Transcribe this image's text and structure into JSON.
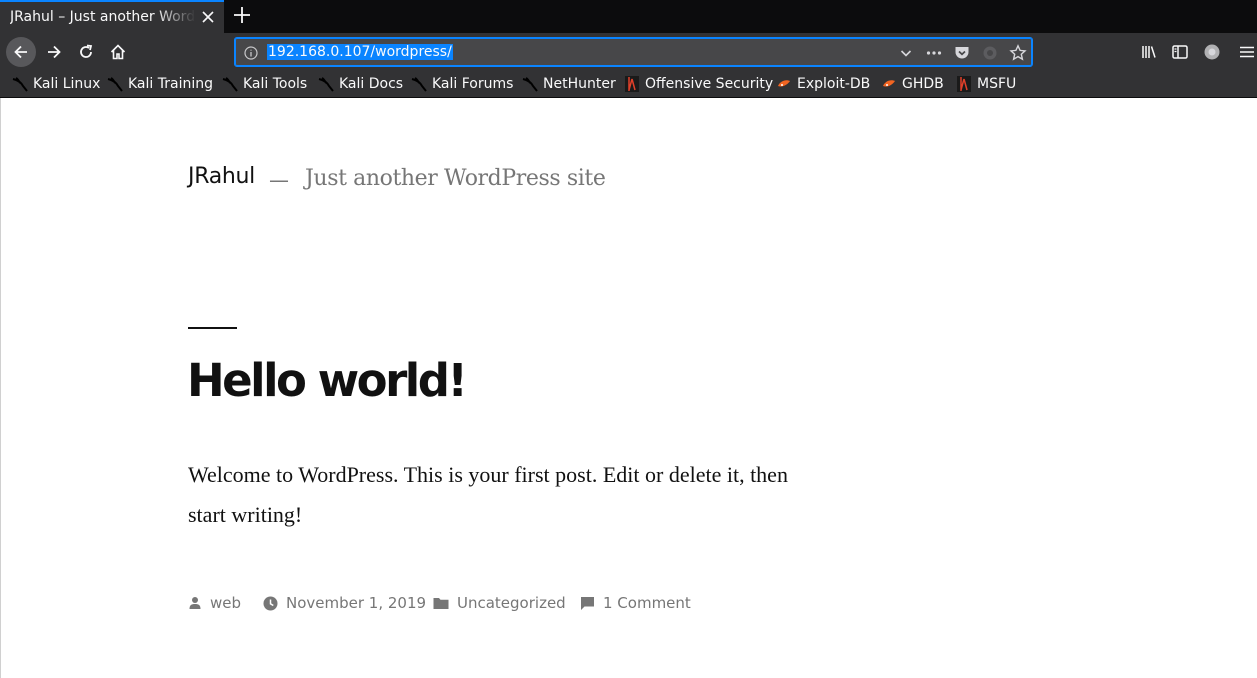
{
  "browser": {
    "tab_title": "JRahul – Just another WordPress site",
    "url": "192.168.0.107/wordpress/"
  },
  "bookmarks": [
    {
      "label": "Kali Linux",
      "icon": "kali-dragon-icon"
    },
    {
      "label": "Kali Training",
      "icon": "kali-dragon-icon"
    },
    {
      "label": "Kali Tools",
      "icon": "kali-dragon-icon"
    },
    {
      "label": "Kali Docs",
      "icon": "kali-dragon-icon"
    },
    {
      "label": "Kali Forums",
      "icon": "kali-dragon-icon"
    },
    {
      "label": "NetHunter",
      "icon": "kali-dragon-icon"
    },
    {
      "label": "Offensive Security",
      "icon": "offsec-icon"
    },
    {
      "label": "Exploit-DB",
      "icon": "exploitdb-icon"
    },
    {
      "label": "GHDB",
      "icon": "exploitdb-icon"
    },
    {
      "label": "MSFU",
      "icon": "offsec-icon"
    }
  ],
  "site": {
    "title": "JRahul",
    "separator": "—",
    "description": "Just another WordPress site"
  },
  "post": {
    "title": "Hello world!",
    "content": "Welcome to WordPress. This is your first post. Edit or delete it, then start writing!",
    "author": "web",
    "date": "November 1, 2019",
    "category": "Uncategorized",
    "comments": "1 Comment"
  },
  "colors": {
    "accent": "#0a84ff",
    "toolbar": "#323234",
    "meta_text": "#767676"
  }
}
